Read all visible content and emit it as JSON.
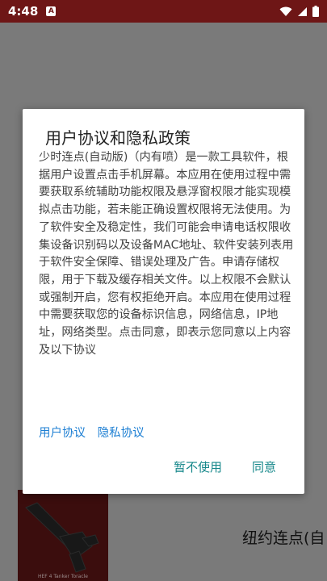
{
  "status_bar": {
    "time": "4:48",
    "notification_glyph": "A",
    "icons": [
      "wifi-icon",
      "signal-icon",
      "battery-icon"
    ]
  },
  "background": {
    "app_title": "纽约连点(自",
    "thumb_caption": "HEF 4 Tanker Toracle",
    "accent": "#6e1616"
  },
  "dialog": {
    "title": "用户协议和隐私政策",
    "body": "少时连点(自动版)（内有喷）是一款工具软件，根据用户设置点击手机屏幕。本应用在使用过程中需要获取系统辅助功能权限及悬浮窗权限才能实现模拟点击功能，若未能正确设置权限将无法使用。为了软件安全及稳定性，我们可能会申请电话权限收集设备识别码以及设备MAC地址、软件安装列表用于软件安全保障、错误处理及广告。申请存储权限，用于下载及缓存相关文件。以上权限不会默认或强制开启，您有权拒绝开启。本应用在使用过程中需要获取您的设备标识信息，网络信息，IP地址，网络类型。点击同意，即表示您同意以上内容及以下协议",
    "user_agreement_link": "用户协议",
    "privacy_policy_link": "隐私协议",
    "decline_label": "暂不使用",
    "agree_label": "同意",
    "link_color": "#1d7fd3",
    "button_color": "#15878a"
  }
}
